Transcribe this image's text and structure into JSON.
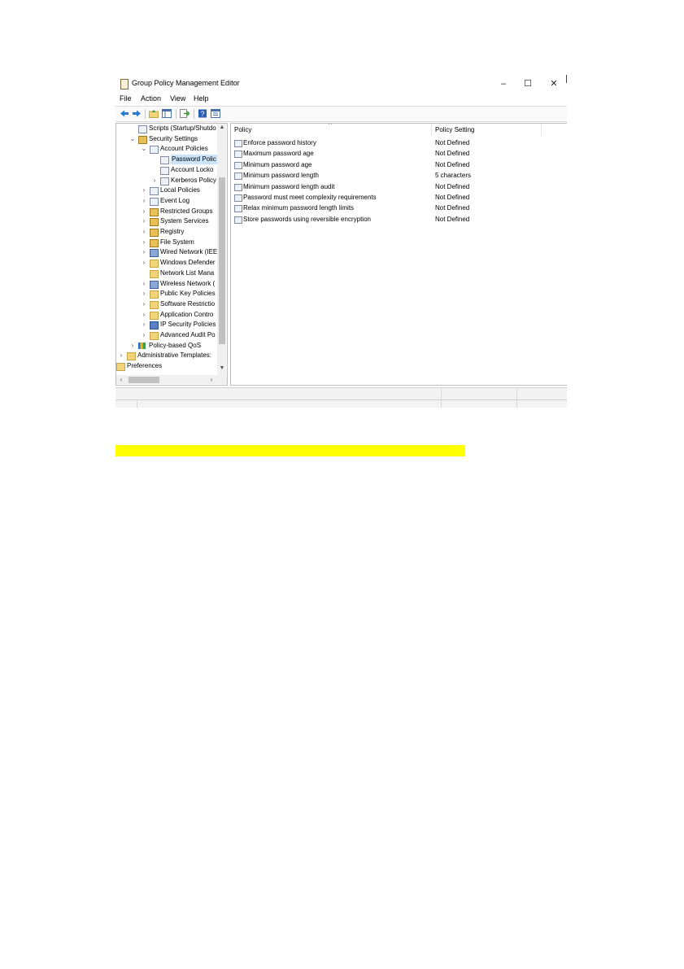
{
  "window": {
    "title": "Group Policy Management Editor",
    "controls": {
      "minimize": "–",
      "maximize": "☐",
      "close": "✕"
    }
  },
  "menu": [
    "File",
    "Action",
    "View",
    "Help"
  ],
  "toolbar": [
    "back-icon",
    "forward-icon",
    "up-folder-icon",
    "show-hide-tree-icon",
    "export-list-icon",
    "help-icon",
    "properties-icon"
  ],
  "tree": {
    "items": [
      {
        "label": "Scripts (Startup/Shutdo",
        "chevron": "",
        "icon": "doc"
      },
      {
        "label": "Security Settings",
        "chevron": "⌄",
        "icon": "lock"
      },
      {
        "label": "Account Policies",
        "chevron": "⌄",
        "icon": "doc"
      },
      {
        "label": "Password Polic",
        "chevron": "",
        "icon": "doc",
        "selected": true
      },
      {
        "label": "Account Locko",
        "chevron": "",
        "icon": "doc"
      },
      {
        "label": "Kerberos Policy",
        "chevron": "›",
        "icon": "doc"
      },
      {
        "label": "Local Policies",
        "chevron": "›",
        "icon": "doc"
      },
      {
        "label": "Event Log",
        "chevron": "›",
        "icon": "doc"
      },
      {
        "label": "Restricted Groups",
        "chevron": "›",
        "icon": "lock"
      },
      {
        "label": "System Services",
        "chevron": "›",
        "icon": "lock"
      },
      {
        "label": "Registry",
        "chevron": "›",
        "icon": "lock"
      },
      {
        "label": "File System",
        "chevron": "›",
        "icon": "lock"
      },
      {
        "label": "Wired Network (IEE",
        "chevron": "›",
        "icon": "net"
      },
      {
        "label": "Windows Defender",
        "chevron": "›",
        "icon": "folder"
      },
      {
        "label": "Network List Mana",
        "chevron": "",
        "icon": "folder"
      },
      {
        "label": "Wireless Network (",
        "chevron": "›",
        "icon": "net"
      },
      {
        "label": "Public Key Policies",
        "chevron": "›",
        "icon": "folder"
      },
      {
        "label": "Software Restrictio",
        "chevron": "›",
        "icon": "folder"
      },
      {
        "label": "Application Contro",
        "chevron": "›",
        "icon": "folder"
      },
      {
        "label": "IP Security Policies",
        "chevron": "›",
        "icon": "shield"
      },
      {
        "label": "Advanced Audit Po",
        "chevron": "›",
        "icon": "folder"
      },
      {
        "label": "Policy-based QoS",
        "chevron": "›",
        "icon": "qos"
      },
      {
        "label": "Administrative Templates:",
        "chevron": "›",
        "icon": "folder"
      },
      {
        "label": "Preferences",
        "chevron": "",
        "icon": "folder"
      }
    ]
  },
  "list": {
    "columns": [
      "Policy",
      "Policy Setting"
    ],
    "rows": [
      {
        "policy": "Enforce password history",
        "setting": "Not Defined"
      },
      {
        "policy": "Maximum password age",
        "setting": "Not Defined"
      },
      {
        "policy": "Minimum password age",
        "setting": "Not Defined"
      },
      {
        "policy": "Minimum password length",
        "setting": "5 characters"
      },
      {
        "policy": "Minimum password length audit",
        "setting": "Not Defined"
      },
      {
        "policy": "Password must meet complexity requirements",
        "setting": "Not Defined"
      },
      {
        "policy": "Relax minimum password length limits",
        "setting": "Not Defined"
      },
      {
        "policy": "Store passwords using reversible encryption",
        "setting": "Not Defined"
      }
    ]
  },
  "colors": {
    "highlight": "#ffff00",
    "selection": "#cce4f7"
  }
}
